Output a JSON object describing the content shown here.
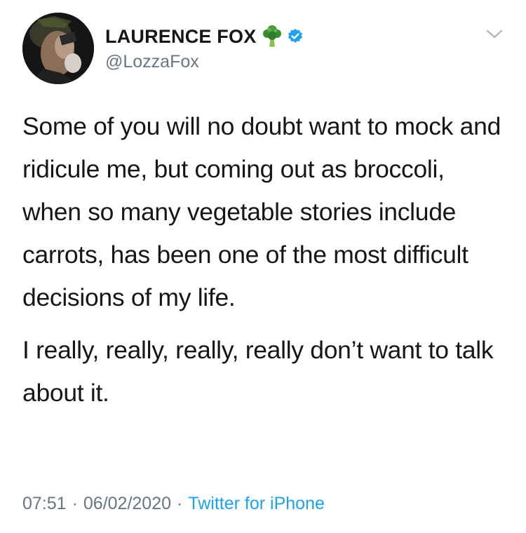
{
  "tweet": {
    "author": {
      "display_name": "LAURENCE FOX",
      "handle": "@LozzaFox"
    },
    "paragraphs": [
      "Some of you will no doubt want to mock and ridicule me, but coming out as broccoli, when so many vegetable stories include carrots, has been one of the most difficult decisions of my life.",
      "I really, really, really, really don’t want to talk about it."
    ],
    "meta": {
      "time": "07:51",
      "separator": "·",
      "date": "06/02/2020",
      "source": "Twitter for iPhone"
    }
  },
  "icons": {
    "name_emoji": "broccoli-icon",
    "badge": "verified-icon",
    "menu": "chevron-down-icon"
  },
  "colors": {
    "text": "#14171a",
    "secondary": "#657786",
    "link": "#1da1f2",
    "verified": "#1da1f2",
    "background": "#ffffff"
  }
}
